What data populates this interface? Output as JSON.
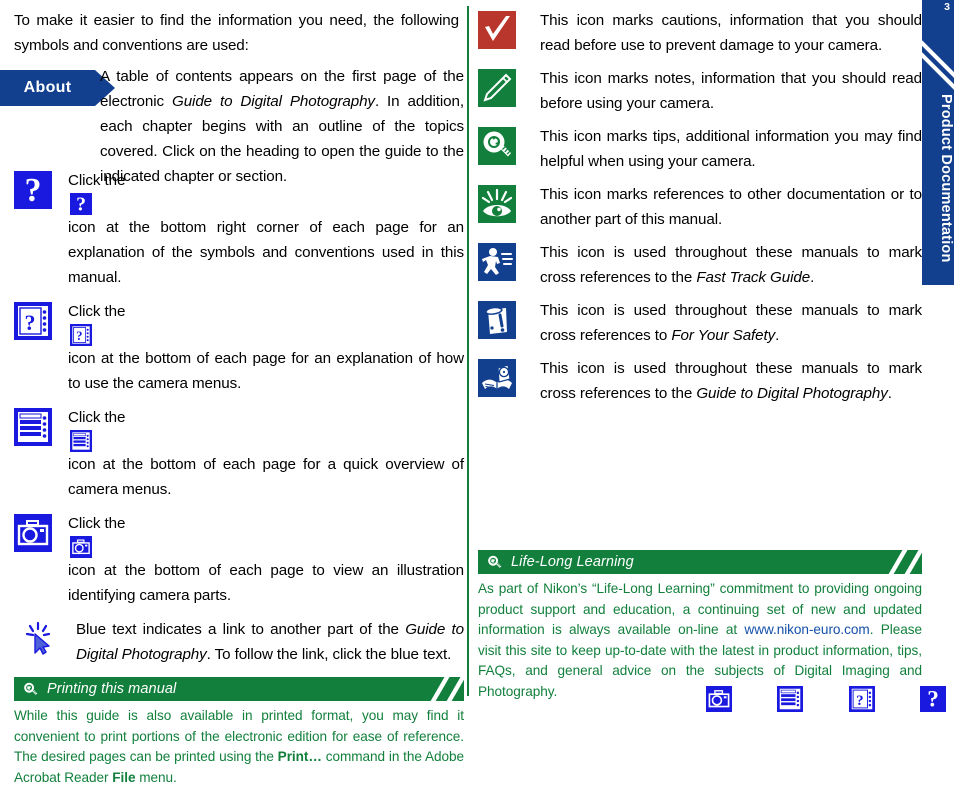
{
  "page_number": "3",
  "side_tab": {
    "label": "Product Documentation",
    "color": "#123f8e"
  },
  "colors": {
    "brand_blue": "#123f8e",
    "icon_blue": "#1919e0",
    "green": "#12803c",
    "red": "#b9362c",
    "link_blue": "#1550a8"
  },
  "left": {
    "intro": "To make it easier to find the information you need, the following symbols and conventions are used:",
    "about": {
      "badge": "About",
      "text_parts": {
        "a": "A table of contents appears on the first page of the electronic ",
        "italic1": "Guide to Digital Photography",
        "b": ".  In addition, each chapter begins with an outline of the topics covered.  Click on the heading to open the guide to the indicated chapter or section."
      }
    },
    "items": [
      {
        "icon": "help-question-icon",
        "inline_icon": "help-question-icon",
        "text_before": "Click the ",
        "text_after": " icon at the bottom right corner of each page for an explanation of the symbols and conventions used in this manual."
      },
      {
        "icon": "menu-help-icon",
        "inline_icon": "menu-help-icon",
        "text_before": "Click the ",
        "text_after": " icon at the bottom of each page for an explanation of how to use the camera menus."
      },
      {
        "icon": "menu-list-icon",
        "inline_icon": "menu-list-icon",
        "text_before": "Click the ",
        "text_after": " icon at the bottom of each page for a quick overview of camera menus."
      },
      {
        "icon": "camera-icon",
        "inline_icon": "camera-icon",
        "text_before": "Click the ",
        "text_after": " icon at the bottom of each page to view an illustration identifying camera parts."
      },
      {
        "icon": "cursor-click-icon",
        "inline_icon": "",
        "text_before": "",
        "text_after": ""
      }
    ],
    "blue_text_item": {
      "a": "Blue text indicates a link to another part of the ",
      "italic1": "Guide to Digital Photography",
      "b": ". To follow the link, click the blue text."
    },
    "callout": {
      "icon": "tip-bulb-icon",
      "title": "Printing this manual",
      "body": {
        "a": "While this guide is also available in printed format, you may find it convenient to print portions of the electronic edition for ease of reference. The desired pages can be printed using the ",
        "bold1": "Print…",
        "b": " command in the Adobe Acrobat Reader ",
        "bold2": "File",
        "c": " menu."
      }
    }
  },
  "right": {
    "items": [
      {
        "icon": "caution-check-icon",
        "icon_color": "#b9362c",
        "text": "This icon marks cautions, information that you should read before use to prevent damage to your camera."
      },
      {
        "icon": "note-pencil-icon",
        "icon_color": "#12803c",
        "text": "This icon marks notes, information that you should read before using your camera."
      },
      {
        "icon": "tip-bulb-icon",
        "icon_color": "#12803c",
        "text": "This icon marks tips, additional information you may find helpful when using your camera."
      },
      {
        "icon": "see-also-eye-icon",
        "icon_color": "#12803c",
        "text": "This icon marks references to other documentation or to another part of this manual."
      },
      {
        "icon": "fast-track-runner-icon",
        "icon_color": "#123f8e",
        "text_before": "This icon is used throughout these manuals to mark cross references to the ",
        "italic": "Fast Track Guide",
        "text_after": "."
      },
      {
        "icon": "safety-warning-icon",
        "icon_color": "#123f8e",
        "text_before": "This icon is used throughout these manuals to mark cross references to ",
        "italic": "For Your Safety",
        "text_after": "."
      },
      {
        "icon": "guide-book-icon",
        "icon_color": "#123f8e",
        "text_before": "This icon is used throughout these manuals to mark cross references to the ",
        "italic": "Guide to Digital Photography",
        "text_after": "."
      }
    ],
    "callout": {
      "icon": "tip-bulb-icon",
      "title": "Life-Long Learning",
      "body": {
        "a": "As part of Nikon’s “Life-Long Learning” commitment to providing ongoing product support and education, a continuing set of new and updated information is always available on-line at ",
        "link": "www.nikon-euro.com",
        "b": ".  Please visit this site to keep up-to-date with the latest in product information, tips, FAQs, and general advice on the subjects of Digital Imaging and Photography."
      }
    }
  },
  "bottom_nav": [
    {
      "icon": "camera-icon",
      "name": "camera-parts-button"
    },
    {
      "icon": "menu-list-icon",
      "name": "menu-overview-button"
    },
    {
      "icon": "menu-help-icon",
      "name": "menu-help-button"
    },
    {
      "icon": "help-question-icon",
      "name": "symbols-help-button"
    }
  ]
}
